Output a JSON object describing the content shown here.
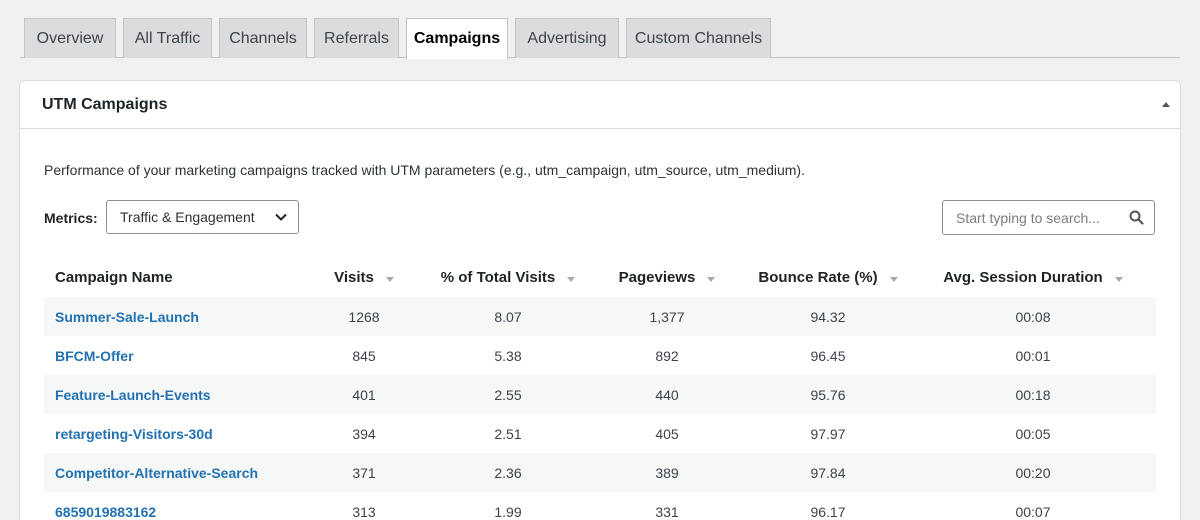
{
  "tabs": [
    {
      "label": "Overview",
      "active": false
    },
    {
      "label": "All Traffic",
      "active": false
    },
    {
      "label": "Channels",
      "active": false
    },
    {
      "label": "Referrals",
      "active": false
    },
    {
      "label": "Campaigns",
      "active": true
    },
    {
      "label": "Advertising",
      "active": false
    },
    {
      "label": "Custom Channels",
      "active": false
    }
  ],
  "panel": {
    "title": "UTM Campaigns",
    "collapse_icon": "triangle-up-icon",
    "description": "Performance of your marketing campaigns tracked with UTM parameters (e.g., utm_campaign, utm_source, utm_medium)."
  },
  "metrics": {
    "label": "Metrics:",
    "selected": "Traffic & Engagement",
    "icon": "chevron-down-icon"
  },
  "search": {
    "placeholder": "Start typing to search...",
    "value": "",
    "icon": "search-icon"
  },
  "table": {
    "columns": [
      "Campaign Name",
      "Visits",
      "% of Total Visits",
      "Pageviews",
      "Bounce Rate (%)",
      "Avg. Session Duration"
    ],
    "rows": [
      {
        "name": "Summer-Sale-Launch",
        "visits": "1268",
        "pct": "8.07",
        "pageviews": "1,377",
        "bounce": "94.32",
        "duration": "00:08"
      },
      {
        "name": "BFCM-Offer",
        "visits": "845",
        "pct": "5.38",
        "pageviews": "892",
        "bounce": "96.45",
        "duration": "00:01"
      },
      {
        "name": "Feature-Launch-Events",
        "visits": "401",
        "pct": "2.55",
        "pageviews": "440",
        "bounce": "95.76",
        "duration": "00:18"
      },
      {
        "name": "retargeting-Visitors-30d",
        "visits": "394",
        "pct": "2.51",
        "pageviews": "405",
        "bounce": "97.97",
        "duration": "00:05"
      },
      {
        "name": "Competitor-Alternative-Search",
        "visits": "371",
        "pct": "2.36",
        "pageviews": "389",
        "bounce": "97.84",
        "duration": "00:20"
      },
      {
        "name": "6859019883162",
        "visits": "313",
        "pct": "1.99",
        "pageviews": "331",
        "bounce": "96.17",
        "duration": "00:07"
      }
    ]
  },
  "colors": {
    "link": "#2271b1",
    "page_bg": "#f0f0f1",
    "tab_bg": "#dcdcde",
    "stripe": "#f6f7f7"
  }
}
